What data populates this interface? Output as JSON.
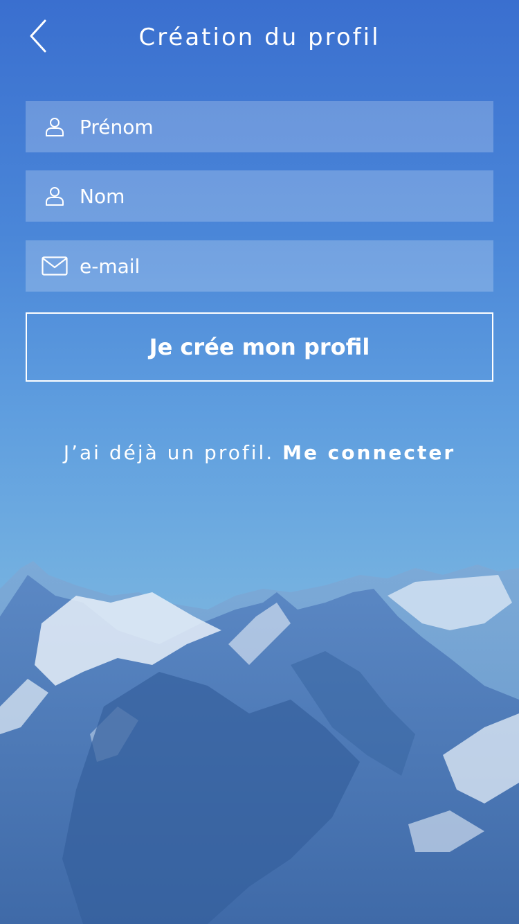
{
  "header": {
    "title": "Création du profil",
    "back_icon": "chevron-left-icon"
  },
  "form": {
    "first_name": {
      "placeholder": "Prénom",
      "value": "",
      "icon": "user-icon"
    },
    "last_name": {
      "placeholder": "Nom",
      "value": "",
      "icon": "user-icon"
    },
    "email": {
      "placeholder": "e-mail",
      "value": "",
      "icon": "envelope-icon"
    },
    "submit_label": "Je crée mon profil"
  },
  "login": {
    "prompt": "J’ai déjà un profil.",
    "link_label": "Me connecter"
  },
  "colors": {
    "gradient_top": "#3a6fcf",
    "gradient_bottom": "#8ab7d8",
    "text": "#ffffff"
  }
}
